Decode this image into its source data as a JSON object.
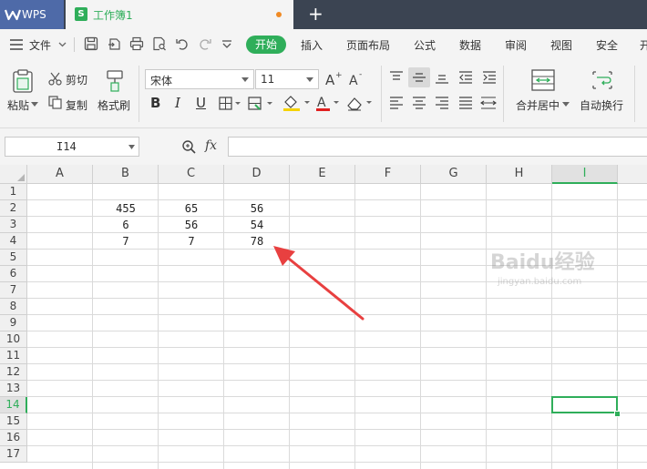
{
  "app": {
    "name": "WPS",
    "document_title": "工作簿1"
  },
  "menu": {
    "file": "文件",
    "tabs": [
      "开始",
      "插入",
      "页面布局",
      "公式",
      "数据",
      "审阅",
      "视图",
      "安全",
      "开"
    ]
  },
  "ribbon": {
    "paste": "粘贴",
    "cut": "剪切",
    "copy": "复制",
    "format_painter": "格式刷",
    "font_name": "宋体",
    "font_size": "11",
    "merge_center": "合并居中",
    "wrap_text": "自动换行"
  },
  "formula_bar": {
    "name_box": "I14",
    "fx_label": "fx",
    "formula": ""
  },
  "sheet": {
    "columns": [
      "A",
      "B",
      "C",
      "D",
      "E",
      "F",
      "G",
      "H",
      "I"
    ],
    "rows": [
      "1",
      "2",
      "3",
      "4",
      "5",
      "6",
      "7",
      "8",
      "9",
      "10",
      "11",
      "12",
      "13",
      "14",
      "15",
      "16",
      "17"
    ],
    "active_cell": "I14",
    "cells": {
      "B2": "455",
      "C2": "65",
      "D2": "56",
      "B3": "6",
      "C3": "56",
      "D3": "54",
      "B4": "7",
      "C4": "7",
      "D4": "78"
    }
  },
  "watermark": {
    "text": "Baidu经验",
    "sub": "jingyan.baidu.com"
  },
  "colors": {
    "accent": "#2fae5a",
    "tabbar": "#3b4452",
    "wps_tab": "#4e6aa8",
    "annotation": "#e84040"
  }
}
